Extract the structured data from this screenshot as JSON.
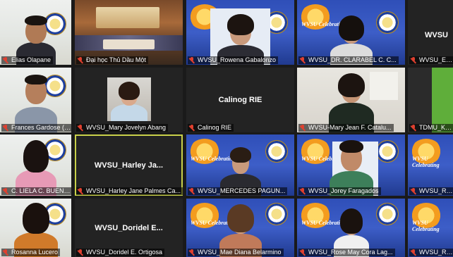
{
  "participants": [
    {
      "label": "Elias Olapane"
    },
    {
      "label": "Đại học Thủ Dầu Một"
    },
    {
      "label": "WVSU_Rowena Gabalonzo"
    },
    {
      "label": "WVSU_DR. CLARABEL C. C..."
    },
    {
      "label": "WVSU_Enri...",
      "center_name": "WVSU"
    },
    {
      "label": "Frances Gardose (E..."
    },
    {
      "label": "WVSU_Mary Jovelyn Abang"
    },
    {
      "label": "Calinog RIE",
      "center_name": "Calinog RIE"
    },
    {
      "label": "WVSU-Mary Jean F. Catalu..."
    },
    {
      "label": "TDMU_Khu..."
    },
    {
      "label": "C. LIELA C. BUENVI..."
    },
    {
      "label": "WVSU_Harley Jane Palmes Ca...",
      "center_name": "WVSU_Harley Ja..."
    },
    {
      "label": "WVSU_MERCEDES PAGUN..."
    },
    {
      "label": "WVSU_Jorey Faragados"
    },
    {
      "label": "WVSU_Re..."
    },
    {
      "label": "Rosanna Lucero"
    },
    {
      "label": "WVSU_Doridel E. Ortigosa",
      "center_name": "WVSU_Doridel E..."
    },
    {
      "label": "WVSU_Mae Diana Belarmino"
    },
    {
      "label": "WVSU_Rose May Cora Lag..."
    },
    {
      "label": "WVSU_Re..."
    }
  ],
  "banner": {
    "text": "WVSU Celebrating"
  },
  "icons": {
    "mic": "mic-muted-icon",
    "seal": "university-seal-icon"
  },
  "colors": {
    "active_border": "#c9d14a",
    "mic_muted": "#e0402f"
  }
}
